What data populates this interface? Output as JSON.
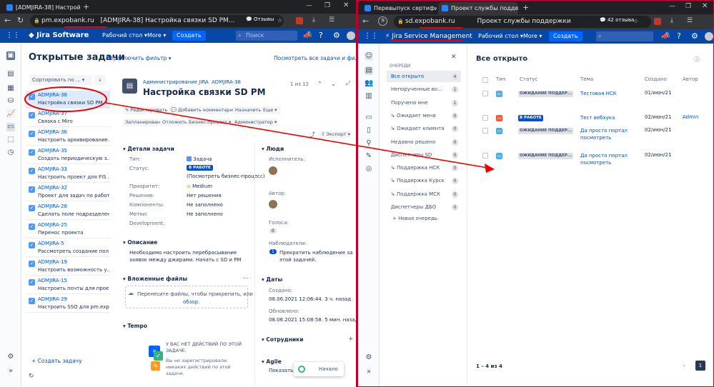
{
  "left": {
    "tabs": [
      {
        "label": "[ADMJIRA-38] Настройки"
      },
      {
        "label": "[ADMJIRA-38] Настройка связки SD PM..."
      }
    ],
    "url": "pm.expobank.ru",
    "page_title": "[ADMJIRA-38] Настройка связки SD PM...",
    "reviews": "Отзывы",
    "jira": {
      "brand": "Jira Software",
      "nav": [
        "Рабочий стол",
        "More"
      ],
      "create": "Создать",
      "search_placeholder": "Поиск"
    },
    "list": {
      "title": "Открытые задачи",
      "switch_filter": "Переключить фильтр",
      "view_all": "Посмотреть все задачи и фильтры",
      "sort": "Сортировать по ...",
      "items": [
        {
          "key": "ADMJIRA-38",
          "summary": "Настройка связки SD PM"
        },
        {
          "key": "ADMJIRA-37",
          "summary": "Связка с Miro"
        },
        {
          "key": "ADMJIRA-36",
          "summary": "Настроить архивирование..."
        },
        {
          "key": "ADMJIRA-35",
          "summary": "Создать периодическую з..."
        },
        {
          "key": "ADMJIRA-33",
          "summary": "Настроить проект для FIS ..."
        },
        {
          "key": "ADMJIRA-32",
          "summary": "Проект для задач по работ..."
        },
        {
          "key": "ADMJIRA-28",
          "summary": "Сделать поле подразделен..."
        },
        {
          "key": "ADMJIRA-25",
          "summary": "Перенос проекта"
        },
        {
          "key": "ADMJIRA-5",
          "summary": "Рассмотреть создание пол..."
        },
        {
          "key": "ADMJIRA-19",
          "summary": "Настроить возможность у..."
        },
        {
          "key": "ADMJIRA-15",
          "summary": "Настроить почты для прое..."
        },
        {
          "key": "ADMJIRA-29",
          "summary": "Настроить SSO для pm.exp..."
        }
      ],
      "create_task": "Создать задачу"
    },
    "issue": {
      "breadcrumb_project": "Администрирование JIRA",
      "breadcrumb_key": "ADMJIRA-38",
      "title": "Настройка связки SD PM",
      "pager": "1 из 12",
      "actions": [
        "Редактировать",
        "Добавить комментарий",
        "Назначить",
        "Еще"
      ],
      "actions2": [
        "Запланировано",
        "Отложить",
        "Бизнес-процесс",
        "Администратор"
      ],
      "export": "Экспорт",
      "details_title": "Детали задачи",
      "fields": [
        {
          "label": "Тип:",
          "value": "Задача"
        },
        {
          "label": "Статус:",
          "value": "В РАБОТЕ"
        },
        {
          "label": "",
          "value": "(Посмотреть бизнес-процесс)"
        },
        {
          "label": "Приоритет:",
          "value": "Medium"
        },
        {
          "label": "Решение:",
          "value": "Нет решения"
        },
        {
          "label": "Компоненты:",
          "value": "Не заполнено"
        },
        {
          "label": "Метки:",
          "value": "Не заполнено"
        },
        {
          "label": "Development:",
          "value": ""
        }
      ],
      "description_title": "Описание",
      "description": "Необходимо настроить перебрасывание заявок между джирами. Начать с SD и PM",
      "attachments_title": "Вложенные файлы",
      "attachments_hint_1": "Перенесите файлы, чтобы прикрепить, или",
      "attachments_hint_2": "обзор.",
      "tempo_title": "Tempo",
      "tempo_msg_1": "У ВАС НЕТ ДЕЙСТВИЙ ПО ЭТОЙ ЗАДАЧЕ.",
      "tempo_msg_2": "Вы не зарегистрировали никаких действий по этой задаче.",
      "people_title": "Люди",
      "assignee_label": "Исполнитель:",
      "reporter_label": "Автор:",
      "votes_label": "Голоса:",
      "votes": "0",
      "watchers_label": "Наблюдатели:",
      "watchers_count": "1",
      "watchers_action": "Прекратить наблюдение за этой задачей.",
      "dates_title": "Даты",
      "created_label": "Создано:",
      "created": "08.06.2021 12:06:44. 3 ч. назад",
      "updated_label": "Обновлено:",
      "updated": "08.06.2021 15:08:58. 5 мин. назад",
      "employees_title": "Сотрудники",
      "agile_title": "Agile",
      "agile_link": "Показать н",
      "start": "Начало"
    }
  },
  "right": {
    "tabs": [
      {
        "label": "Перевыпуск сертификат"
      },
      {
        "label": "Проект службы поддерж"
      }
    ],
    "url": "sd.expobank.ru",
    "page_title": "Проект службы поддержки",
    "reviews": "42 отзыва",
    "jira": {
      "brand": "Jira Service Management",
      "nav": [
        "Рабочий стол",
        "More"
      ],
      "create": "Создать"
    },
    "queues": {
      "header": "ОЧЕРЕДИ",
      "items": [
        {
          "label": "Все открыто",
          "count": "4"
        },
        {
          "label": "Непорученные во...",
          "count": "1"
        },
        {
          "label": "Поручено мне",
          "count": "1"
        },
        {
          "label": "Ожидает меня",
          "count": "0"
        },
        {
          "label": "Ожидает клиента",
          "count": "0"
        },
        {
          "label": "Недавно решено",
          "count": "0"
        },
        {
          "label": "Диспетчеры SD",
          "count": "0"
        },
        {
          "label": "Поддержка НСК",
          "count": "0"
        },
        {
          "label": "Поддержка Курск",
          "count": "0"
        },
        {
          "label": "Поддержка МСК",
          "count": "0"
        },
        {
          "label": "Диспетчеры ДБО",
          "count": "0"
        }
      ],
      "new_queue": "Новая очередь"
    },
    "table": {
      "title": "Все открыто",
      "columns": [
        "Тип",
        "Статус",
        "Тема",
        "Создано",
        "Автор"
      ],
      "rows": [
        {
          "status": "ОЖИДАНИЕ ПОДДЕР...",
          "topic": "Тестовая НСК",
          "created": "01/июн/21",
          "author": ""
        },
        {
          "status": "В РАБОТЕ",
          "topic": "Тест вебхука",
          "created": "02/июн/21",
          "author": "Admin"
        },
        {
          "status": "ОЖИДАНИЕ ПОДДЕР...",
          "topic": "Да просто портал посмотреть",
          "created": "02/июн/21",
          "author": ""
        },
        {
          "status": "ОЖИДАНИЕ ПОДДЕР...",
          "topic": "Да просто портал посмотреть",
          "created": "02/июн/21",
          "author": ""
        }
      ],
      "footer": "1 – 4 из 4",
      "page": "1"
    }
  },
  "colors": {
    "jira_blue": "#0747a6",
    "accent": "#0052cc",
    "annotation": "#e00000"
  }
}
